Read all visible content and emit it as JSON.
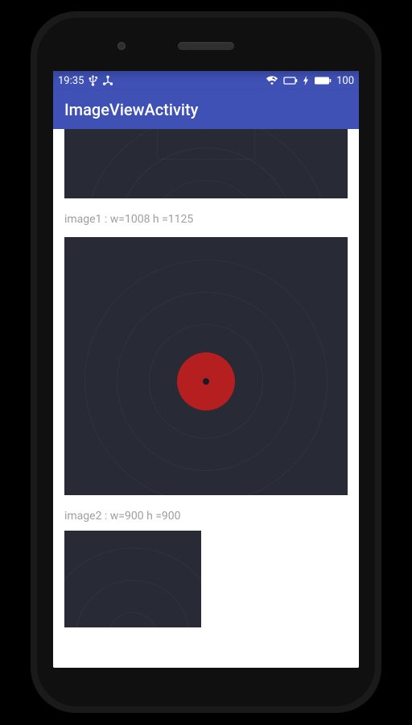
{
  "statusbar": {
    "time": "19:35",
    "battery_pct": "100"
  },
  "appbar": {
    "title": "ImageViewActivity"
  },
  "images": [
    {
      "label": "image1 : w=1008 h =1125"
    },
    {
      "label": "image2 : w=900 h =900"
    }
  ]
}
